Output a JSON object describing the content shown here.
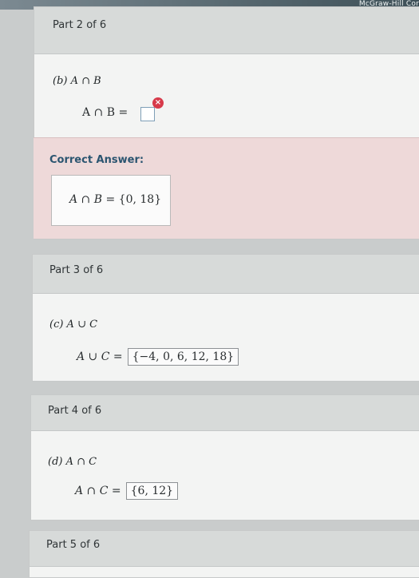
{
  "brand": "McGraw-Hill Cor",
  "part2": {
    "label": "Part 2 of 6",
    "question": "(b) A ∩ B",
    "eq_lhs": "A ∩ B =",
    "correct_title": "Correct Answer:",
    "correct_lhs": "A ∩ B =",
    "correct_value": "{0, 18}"
  },
  "part3": {
    "label": "Part 3 of 6",
    "question": "(c) A ∪ C",
    "eq_lhs": "A ∪ C =",
    "answer": "{−4, 0, 6, 12, 18}"
  },
  "part4": {
    "label": "Part 4 of 6",
    "question": "(d) A ∩ C",
    "eq_lhs": "A ∩ C =",
    "answer": "{6, 12}"
  },
  "part5": {
    "label": "Part 5 of 6"
  }
}
